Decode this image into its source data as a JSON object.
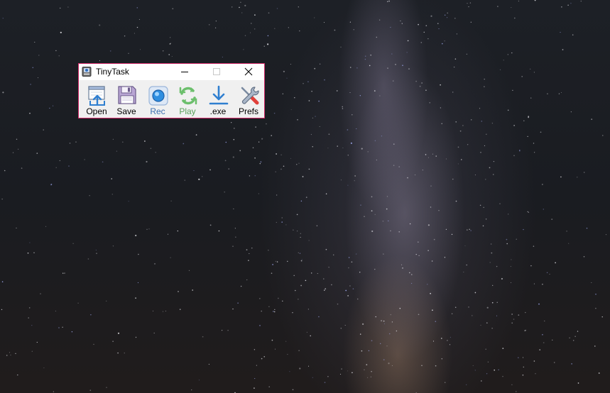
{
  "window": {
    "title": "TinyTask",
    "border_color": "#d3296a"
  },
  "toolbar": {
    "open": {
      "label": "Open",
      "icon": "open-file-icon",
      "color": "#000000"
    },
    "save": {
      "label": "Save",
      "icon": "floppy-disk-icon",
      "color": "#000000"
    },
    "rec": {
      "label": "Rec",
      "icon": "record-icon",
      "color": "#3c6fb0"
    },
    "play": {
      "label": "Play",
      "icon": "play-loop-icon",
      "color": "#5aa05a"
    },
    "exe": {
      "label": ".exe",
      "icon": "download-arrow-icon",
      "color": "#000000"
    },
    "prefs": {
      "label": "Prefs",
      "icon": "wrench-screwdriver-icon",
      "color": "#000000"
    }
  }
}
